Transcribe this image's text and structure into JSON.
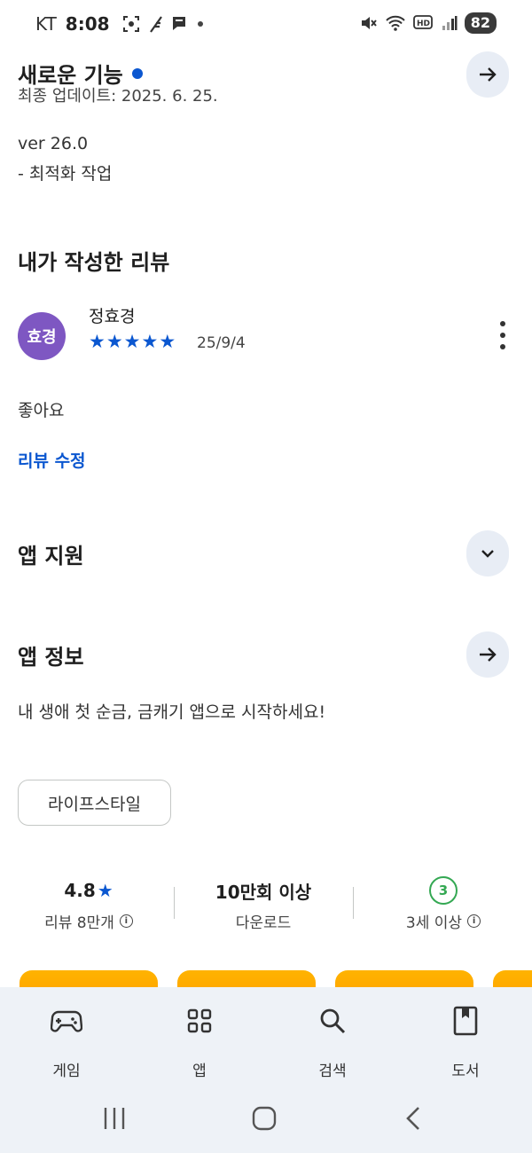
{
  "status_bar": {
    "carrier": "KT",
    "time": "8:08",
    "battery": "82",
    "left_icons": [
      "screenshot-icon",
      "feather-icon",
      "message-icon",
      "dot-icon"
    ],
    "right_icons": [
      "mute-icon",
      "wifi-icon",
      "hd-icon",
      "signal-icon"
    ]
  },
  "whats_new": {
    "title": "새로운 기능",
    "updated": "최종 업데이트: 2025. 6. 25.",
    "version": "ver 26.0",
    "notes": "- 최적화 작업"
  },
  "my_review": {
    "title": "내가 작성한 리뷰",
    "avatar_text": "효경",
    "reviewer": "정효경",
    "rating": 5,
    "date": "25/9/4",
    "text": "좋아요",
    "edit_link": "리뷰 수정"
  },
  "app_support": {
    "title": "앱 지원"
  },
  "app_info": {
    "title": "앱 정보",
    "description": "내 생애 첫 순금, 금캐기 앱으로 시작하세요!",
    "category_chip": "라이프스타일"
  },
  "stats": {
    "rating": "4.8",
    "reviews": "리뷰 8만개",
    "downloads": "10만회 이상",
    "downloads_label": "다운로드",
    "age_badge": "3",
    "age_label": "3세 이상"
  },
  "bottom_nav": {
    "games": "게임",
    "apps": "앱",
    "search": "검색",
    "books": "도서"
  },
  "colors": {
    "accent_blue": "#0b57d0",
    "avatar_purple": "#7e57c2",
    "age_green": "#34a853",
    "button_bg": "#e8edf5",
    "nav_bg": "#eef2f7"
  }
}
